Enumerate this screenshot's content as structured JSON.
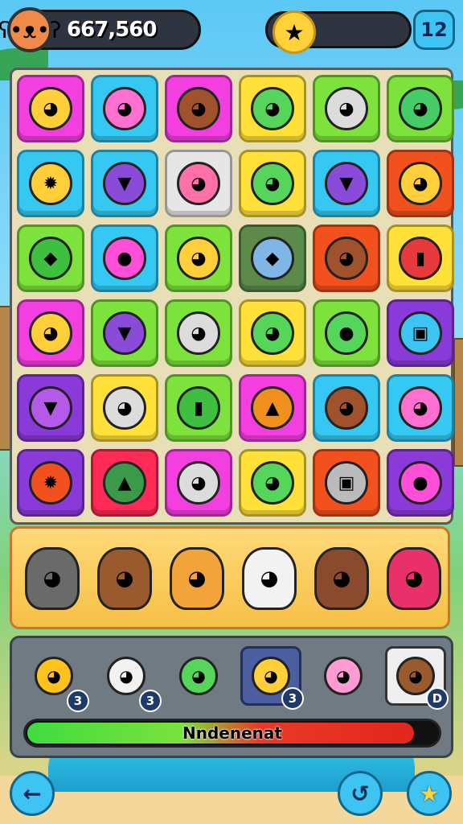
{
  "hud": {
    "score": "667,560",
    "level": "12",
    "avatar_icon": "bear-face-icon",
    "star_icon": "star-creature-icon"
  },
  "board": {
    "rows": [
      [
        {
          "bg": "#f33ee0",
          "fg": "#ffcf3a",
          "icon": "cat-icon",
          "glyph": "◕"
        },
        {
          "bg": "#35c8f2",
          "fg": "#ff6fd2",
          "icon": "fish-icon",
          "glyph": "◕"
        },
        {
          "bg": "#f33ee0",
          "fg": "#a0522d",
          "icon": "bear-icon",
          "glyph": "◕"
        },
        {
          "bg": "#ffe13a",
          "fg": "#55d65a",
          "icon": "frog-icon",
          "glyph": "◕"
        },
        {
          "bg": "#7ee23c",
          "fg": "#dcdcdc",
          "icon": "ghost-icon",
          "glyph": "◕"
        },
        {
          "bg": "#7ee23c",
          "fg": "#44cc66",
          "icon": "turtle-icon",
          "glyph": "◕"
        }
      ],
      [
        {
          "bg": "#35c8f2",
          "fg": "#ffcf3a",
          "icon": "sun-icon",
          "glyph": "✹"
        },
        {
          "bg": "#35c8f2",
          "fg": "#8a4bd8",
          "icon": "cone-icon",
          "glyph": "▼"
        },
        {
          "bg": "#e6e6e6",
          "fg": "#ff6fa8",
          "icon": "fluffy-icon",
          "glyph": "◕"
        },
        {
          "bg": "#ffe13a",
          "fg": "#55d65a",
          "icon": "bug-icon",
          "glyph": "◕"
        },
        {
          "bg": "#35c8f2",
          "fg": "#8a4bd8",
          "icon": "cone-icon",
          "glyph": "▼"
        },
        {
          "bg": "#f2501d",
          "fg": "#ffcf3a",
          "icon": "lion-icon",
          "glyph": "◕"
        }
      ],
      [
        {
          "bg": "#7ee23c",
          "fg": "#3fbf3f",
          "icon": "top-icon",
          "glyph": "◆"
        },
        {
          "bg": "#35c8f2",
          "fg": "#ff4fd8",
          "icon": "lollipop-icon",
          "glyph": "●"
        },
        {
          "bg": "#7ee23c",
          "fg": "#ffcf3a",
          "icon": "cat-icon",
          "glyph": "◕"
        },
        {
          "bg": "#5c8a4a",
          "fg": "#7fb6e6",
          "icon": "leaf-icon",
          "glyph": "◆"
        },
        {
          "bg": "#f2501d",
          "fg": "#a0522d",
          "icon": "bear-icon",
          "glyph": "◕"
        },
        {
          "bg": "#ffe13a",
          "fg": "#e83a3a",
          "icon": "crayon-icon",
          "glyph": "▮"
        }
      ],
      [
        {
          "bg": "#f33ee0",
          "fg": "#ffcf3a",
          "icon": "cat-icon",
          "glyph": "◕"
        },
        {
          "bg": "#7ee23c",
          "fg": "#8a4bd8",
          "icon": "cone-icon",
          "glyph": "▼"
        },
        {
          "bg": "#7ee23c",
          "fg": "#dcdcdc",
          "icon": "ghost-icon",
          "glyph": "◕"
        },
        {
          "bg": "#ffe13a",
          "fg": "#55d65a",
          "icon": "turtle-icon",
          "glyph": "◕"
        },
        {
          "bg": "#7ee23c",
          "fg": "#55d65a",
          "icon": "balloon-icon",
          "glyph": "●"
        },
        {
          "bg": "#8a3ad8",
          "fg": "#3ec4f2",
          "icon": "box-icon",
          "glyph": "▣"
        }
      ],
      [
        {
          "bg": "#8a3ad8",
          "fg": "#b45ae8",
          "icon": "torch-icon",
          "glyph": "▼"
        },
        {
          "bg": "#ffe13a",
          "fg": "#dcdcdc",
          "icon": "ghost-icon",
          "glyph": "◕"
        },
        {
          "bg": "#7ee23c",
          "fg": "#3fbf3f",
          "icon": "bottle-icon",
          "glyph": "▮"
        },
        {
          "bg": "#f33ee0",
          "fg": "#f2901d",
          "icon": "hat-icon",
          "glyph": "▲"
        },
        {
          "bg": "#35c8f2",
          "fg": "#a0522d",
          "icon": "bird-icon",
          "glyph": "◕"
        },
        {
          "bg": "#35c8f2",
          "fg": "#ff6fd2",
          "icon": "fish-icon",
          "glyph": "◕"
        }
      ],
      [
        {
          "bg": "#8a3ad8",
          "fg": "#f2501d",
          "icon": "sun-icon",
          "glyph": "✹"
        },
        {
          "bg": "#ff2a55",
          "fg": "#3a9a4a",
          "icon": "drill-icon",
          "glyph": "▲"
        },
        {
          "bg": "#f33ee0",
          "fg": "#dcdcdc",
          "icon": "cat-icon",
          "glyph": "◕"
        },
        {
          "bg": "#ffe13a",
          "fg": "#55d65a",
          "icon": "bug-icon",
          "glyph": "◕"
        },
        {
          "bg": "#f2501d",
          "fg": "#bbbbbb",
          "icon": "machine-icon",
          "glyph": "▣"
        },
        {
          "bg": "#8a3ad8",
          "fg": "#ff4fd8",
          "icon": "lollipop-icon",
          "glyph": "●"
        }
      ]
    ]
  },
  "shelf": {
    "items": [
      {
        "fg": "#6a6a6a",
        "icon": "cat-icon"
      },
      {
        "fg": "#9a5a2e",
        "icon": "bear-icon"
      },
      {
        "fg": "#f2a33a",
        "icon": "lion-icon"
      },
      {
        "fg": "#f2f2f2",
        "icon": "goat-icon"
      },
      {
        "fg": "#8a4a2e",
        "icon": "bear-icon"
      },
      {
        "fg": "#e8306a",
        "icon": "gnome-icon"
      }
    ]
  },
  "tray": {
    "slots": [
      {
        "fg": "#ffc21a",
        "icon": "balloon-icon",
        "count": "3",
        "style": ""
      },
      {
        "fg": "#f2f2f2",
        "icon": "fluffy-icon",
        "count": "3",
        "style": ""
      },
      {
        "fg": "#55d65a",
        "icon": "balloon-icon",
        "count": "",
        "style": ""
      },
      {
        "fg": "#ffcf3a",
        "icon": "cat-icon",
        "count": "3",
        "style": "selected"
      },
      {
        "fg": "#ff9ad2",
        "icon": "pig-icon",
        "count": "",
        "style": ""
      },
      {
        "fg": "#9a5a2e",
        "icon": "bear-icon",
        "count": "D",
        "style": "light"
      }
    ],
    "progress_label": "Nndenenat",
    "progress_value": 0.94
  },
  "buttons": {
    "back_glyph": "←",
    "undo_glyph": "↺",
    "star_glyph": "★"
  }
}
